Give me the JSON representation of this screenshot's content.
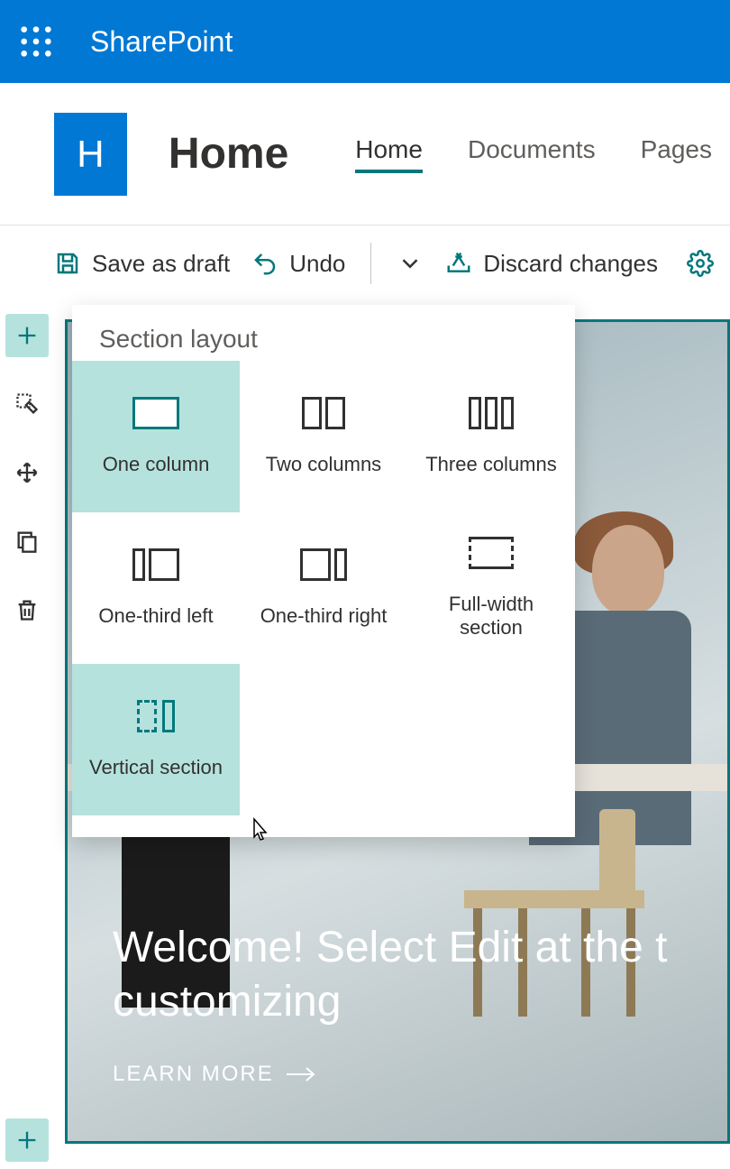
{
  "header": {
    "app_name": "SharePoint",
    "site_logo_letter": "H",
    "site_title": "Home",
    "tabs": [
      "Home",
      "Documents",
      "Pages"
    ],
    "active_tab_index": 0
  },
  "commands": {
    "save_draft": "Save as draft",
    "undo": "Undo",
    "discard": "Discard changes"
  },
  "flyout": {
    "title": "Section layout",
    "options": [
      "One column",
      "Two columns",
      "Three columns",
      "One-third left",
      "One-third right",
      "Full-width section",
      "Vertical section"
    ],
    "selected_indices": [
      0,
      6
    ]
  },
  "hero": {
    "headline": "Welcome! Select Edit at the t\ncustomizing",
    "cta": "LEARN MORE"
  }
}
